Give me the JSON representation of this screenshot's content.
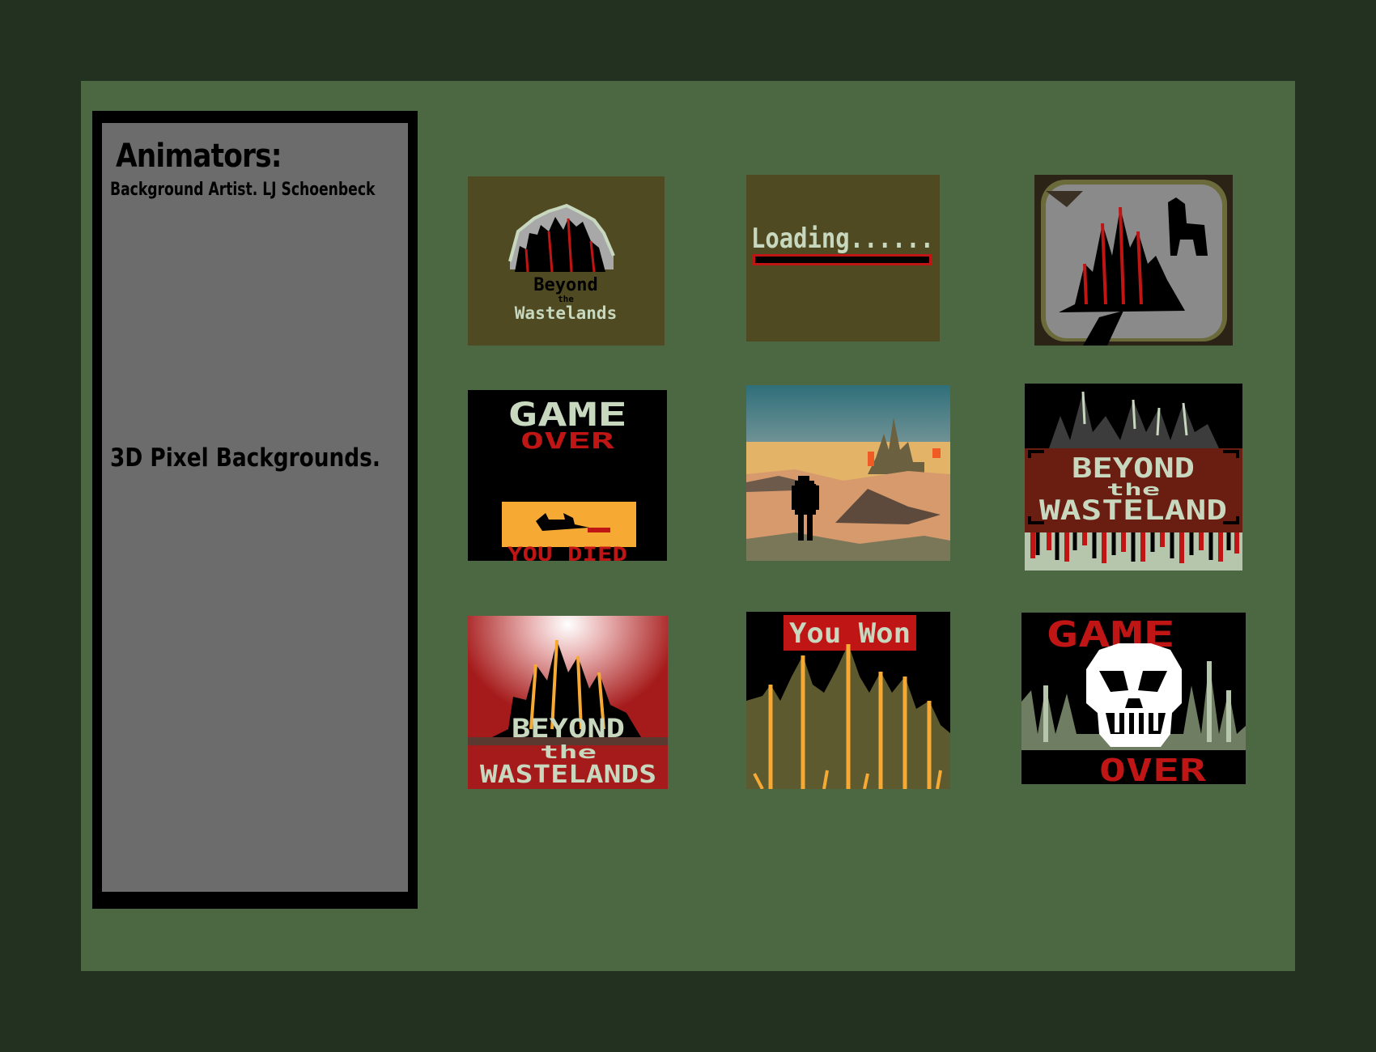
{
  "panel": {
    "heading": "Animators:",
    "credit": "Background Artist. LJ Schoenbeck",
    "caption": "3D Pixel Backgrounds."
  },
  "thumbnails": [
    {
      "name": "title-screen",
      "text_lines": [
        "Beyond",
        "the",
        "Wastelands"
      ]
    },
    {
      "name": "loading-screen",
      "text_lines": [
        "Loading......"
      ]
    },
    {
      "name": "city-in-crater",
      "text_lines": []
    },
    {
      "name": "game-over-died",
      "text_lines": [
        "GAME",
        "OVER",
        "YOU DIED"
      ]
    },
    {
      "name": "desert-wanderer",
      "text_lines": []
    },
    {
      "name": "title-banner",
      "text_lines": [
        "BEYOND",
        "the",
        "WASTELAND"
      ]
    },
    {
      "name": "burning-city-title",
      "text_lines": [
        "BEYOND",
        "the",
        "WASTELANDS"
      ]
    },
    {
      "name": "you-won",
      "text_lines": [
        "You Won"
      ]
    },
    {
      "name": "game-over-skull",
      "text_lines": [
        "GAME",
        "OVER"
      ]
    }
  ]
}
